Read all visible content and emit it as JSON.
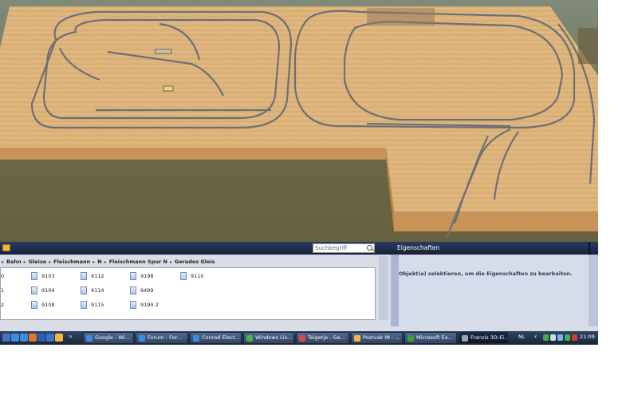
{
  "catalog": {
    "search_placeholder": "Suchbegriff",
    "breadcrumb": [
      "Bahn",
      "Gleise",
      "Fleischmann",
      "N",
      "Fleischmann Spur N",
      "Gerades Gleis"
    ],
    "items": [
      {
        "col": 0,
        "row": 0,
        "label": "0",
        "icon": false
      },
      {
        "col": 0,
        "row": 1,
        "label": "1",
        "icon": false
      },
      {
        "col": 0,
        "row": 2,
        "label": "2",
        "icon": false
      },
      {
        "col": 1,
        "row": 0,
        "label": "9103",
        "icon": true
      },
      {
        "col": 1,
        "row": 1,
        "label": "9104",
        "icon": true
      },
      {
        "col": 1,
        "row": 2,
        "label": "9108",
        "icon": true
      },
      {
        "col": 2,
        "row": 0,
        "label": "9112",
        "icon": true
      },
      {
        "col": 2,
        "row": 1,
        "label": "9114",
        "icon": true
      },
      {
        "col": 2,
        "row": 2,
        "label": "9115",
        "icon": true
      },
      {
        "col": 3,
        "row": 0,
        "label": "9198",
        "icon": true
      },
      {
        "col": 3,
        "row": 1,
        "label": "9499",
        "icon": true
      },
      {
        "col": 3,
        "row": 2,
        "label": "9199 2",
        "icon": true
      },
      {
        "col": 4,
        "row": 0,
        "label": "9110",
        "icon": true
      }
    ]
  },
  "properties": {
    "title": "Eigenschaften",
    "message": "Objekt(e) selektieren, um die Eigenschaften zu bearbeiten."
  },
  "taskbar": {
    "quick_icons": [
      {
        "name": "media-player-icon",
        "color": "#4a6fc2"
      },
      {
        "name": "ie-icon",
        "color": "#3b8de0"
      },
      {
        "name": "ie-icon",
        "color": "#3b8de0"
      },
      {
        "name": "firefox-icon",
        "color": "#e2762c"
      },
      {
        "name": "word-icon",
        "color": "#2b5fb7"
      },
      {
        "name": "outlook-icon",
        "color": "#3a73c9"
      },
      {
        "name": "folder-icon",
        "color": "#f1b83b"
      }
    ],
    "tasks": [
      {
        "label": "Google - Wi...",
        "icon": "ie-icon",
        "color": "#3b8de0",
        "active": false
      },
      {
        "label": "Forum - For...",
        "icon": "ie-icon",
        "color": "#3b8de0",
        "active": false
      },
      {
        "label": "Conrad Elect...",
        "icon": "ie-icon",
        "color": "#3b8de0",
        "active": false
      },
      {
        "label": "Windows Liv...",
        "icon": "messenger-icon",
        "color": "#4caf50",
        "active": false
      },
      {
        "label": "Teigetje - Ge...",
        "icon": "paint-icon",
        "color": "#d84a4a",
        "active": false
      },
      {
        "label": "Postvak IN - ...",
        "icon": "outlook-icon",
        "color": "#f1b83b",
        "active": false
      },
      {
        "label": "Microsoft Ex...",
        "icon": "excel-icon",
        "color": "#3d9a3d",
        "active": false
      },
      {
        "label": "Franzis 3D-Ei...",
        "icon": "app-icon",
        "color": "#9aa5b5",
        "active": true
      }
    ],
    "language": "NL",
    "tray_icons": [
      {
        "name": "shield-icon",
        "color": "#3cb043"
      },
      {
        "name": "speaker-icon",
        "color": "#cfd8e4"
      },
      {
        "name": "network-icon",
        "color": "#7fb2e5"
      },
      {
        "name": "messenger-icon",
        "color": "#4caf50"
      },
      {
        "name": "antivirus-icon",
        "color": "#d23a3a"
      }
    ],
    "clock": "21:09"
  },
  "colors": {
    "panel_header": "#1f2d48",
    "panel_bg": "#d9dde6",
    "table_wood": "#dcb37a",
    "track": "#6d6f75"
  }
}
